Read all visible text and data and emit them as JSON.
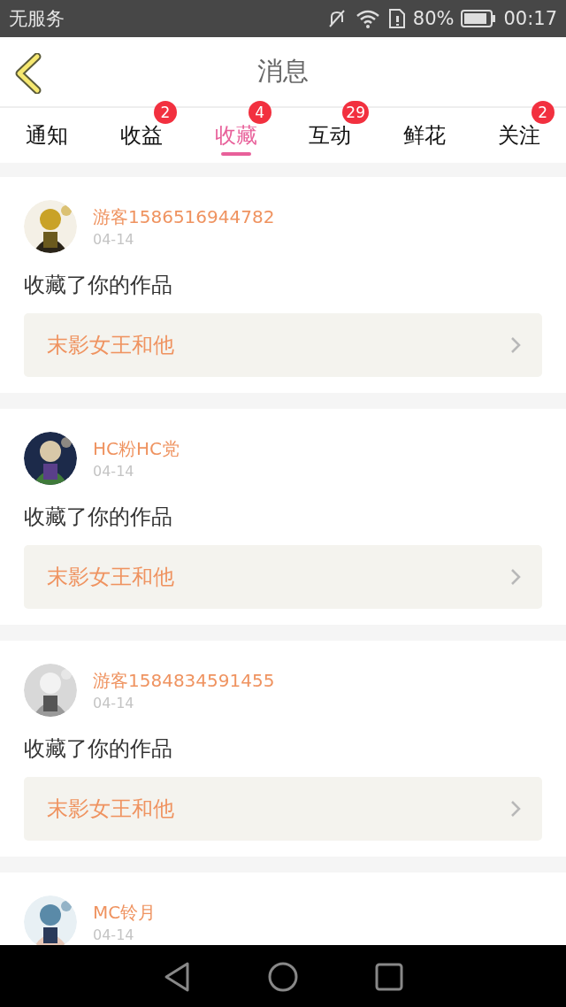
{
  "status_bar": {
    "carrier": "无服务",
    "battery": "80%",
    "time": "00:17"
  },
  "header": {
    "title": "消息"
  },
  "tabs": [
    {
      "label": "通知",
      "selected": false
    },
    {
      "label": "收益",
      "selected": false,
      "badge": "2"
    },
    {
      "label": "收藏",
      "selected": true,
      "badge": "4"
    },
    {
      "label": "互动",
      "selected": false,
      "badge": "29"
    },
    {
      "label": "鲜花",
      "selected": false
    },
    {
      "label": "关注",
      "selected": false,
      "badge": "2"
    }
  ],
  "messages": [
    {
      "user": "游客1586516944782",
      "date": "04-14",
      "text": "收藏了你的作品",
      "work": "末影女王和他"
    },
    {
      "user": "HC粉HC党",
      "date": "04-14",
      "text": "收藏了你的作品",
      "work": "末影女王和他"
    },
    {
      "user": "游客1584834591455",
      "date": "04-14",
      "text": "收藏了你的作品",
      "work": "末影女王和他"
    },
    {
      "user": "MC铃月",
      "date": "04-14"
    }
  ]
}
